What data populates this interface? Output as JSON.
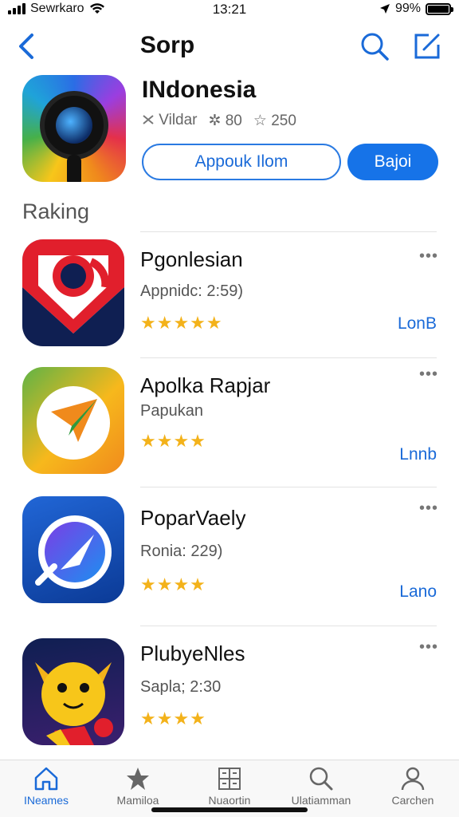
{
  "status": {
    "carrier": "Sewrkaro",
    "time": "13:21",
    "battery": "99%",
    "battery_level": 0.99
  },
  "nav": {
    "title": "Sorp"
  },
  "featured": {
    "name": "INdonesia",
    "meta": [
      "Vildar",
      "80",
      "250"
    ],
    "primary_button": "Appouk Ilom",
    "secondary_button": "Bajoi"
  },
  "section_title": "Raking",
  "apps": [
    {
      "name": "Pgonlesian",
      "sub": "Appnidc: 2:59)",
      "stars": "★★★★★",
      "action": "LonB",
      "more": "•••"
    },
    {
      "name": "Apolka Rapjar",
      "sub": "Papukan",
      "stars": "★★★★",
      "action": "Lnnb",
      "more": "•••"
    },
    {
      "name": "PoparVaely",
      "sub": "Ronia: 229)",
      "stars": "★★★★",
      "action": "Lano",
      "more": "•••"
    },
    {
      "name": "PlubyeNles",
      "sub": "Sapla; 2:30",
      "stars": "★★★★",
      "action": "",
      "more": "•••"
    }
  ],
  "tabs": [
    {
      "label": "INeames",
      "icon": "home-icon"
    },
    {
      "label": "Mamiloa",
      "icon": "star-icon"
    },
    {
      "label": "Nuaortin",
      "icon": "grid-icon"
    },
    {
      "label": "Ulatiamman",
      "icon": "search-icon"
    },
    {
      "label": "Carchen",
      "icon": "person-icon"
    }
  ],
  "colors": {
    "accent": "#1673e8",
    "star": "#f3b21a"
  }
}
